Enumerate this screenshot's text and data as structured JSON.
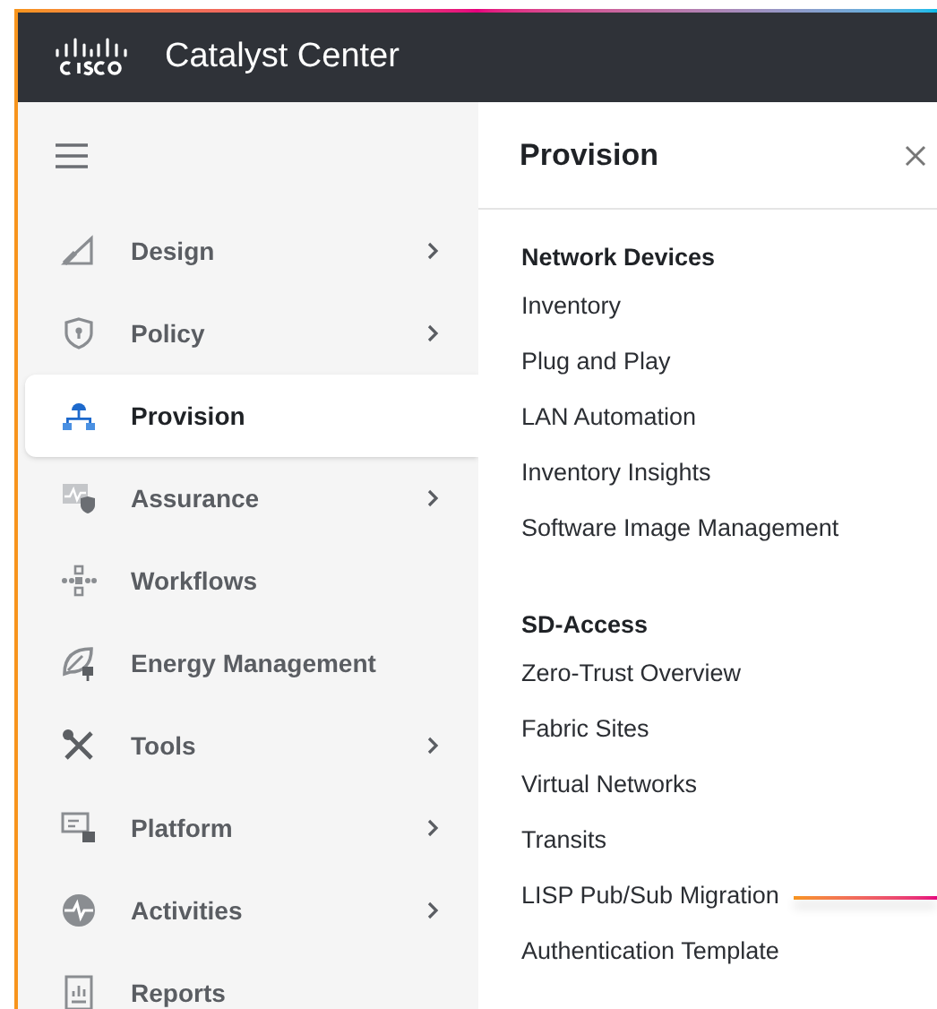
{
  "app": {
    "title": "Catalyst Center"
  },
  "sidebar": {
    "items": [
      {
        "label": "Design",
        "has_submenu": true,
        "selected": false
      },
      {
        "label": "Policy",
        "has_submenu": true,
        "selected": false
      },
      {
        "label": "Provision",
        "has_submenu": false,
        "selected": true
      },
      {
        "label": "Assurance",
        "has_submenu": true,
        "selected": false
      },
      {
        "label": "Workflows",
        "has_submenu": false,
        "selected": false
      },
      {
        "label": "Energy Management",
        "has_submenu": false,
        "selected": false
      },
      {
        "label": "Tools",
        "has_submenu": true,
        "selected": false
      },
      {
        "label": "Platform",
        "has_submenu": true,
        "selected": false
      },
      {
        "label": "Activities",
        "has_submenu": true,
        "selected": false
      },
      {
        "label": "Reports",
        "has_submenu": false,
        "selected": false
      }
    ]
  },
  "panel": {
    "title": "Provision",
    "sections": [
      {
        "heading": "Network Devices",
        "items": [
          {
            "label": "Inventory",
            "highlighted": false
          },
          {
            "label": "Plug and Play",
            "highlighted": false
          },
          {
            "label": "LAN Automation",
            "highlighted": false
          },
          {
            "label": "Inventory Insights",
            "highlighted": false
          },
          {
            "label": "Software Image Management",
            "highlighted": false
          }
        ]
      },
      {
        "heading": "SD-Access",
        "items": [
          {
            "label": "Zero-Trust Overview",
            "highlighted": false
          },
          {
            "label": "Fabric Sites",
            "highlighted": false
          },
          {
            "label": "Virtual Networks",
            "highlighted": false
          },
          {
            "label": "Transits",
            "highlighted": false
          },
          {
            "label": "LISP Pub/Sub Migration",
            "highlighted": true
          },
          {
            "label": "Authentication Template",
            "highlighted": false
          }
        ]
      }
    ]
  }
}
